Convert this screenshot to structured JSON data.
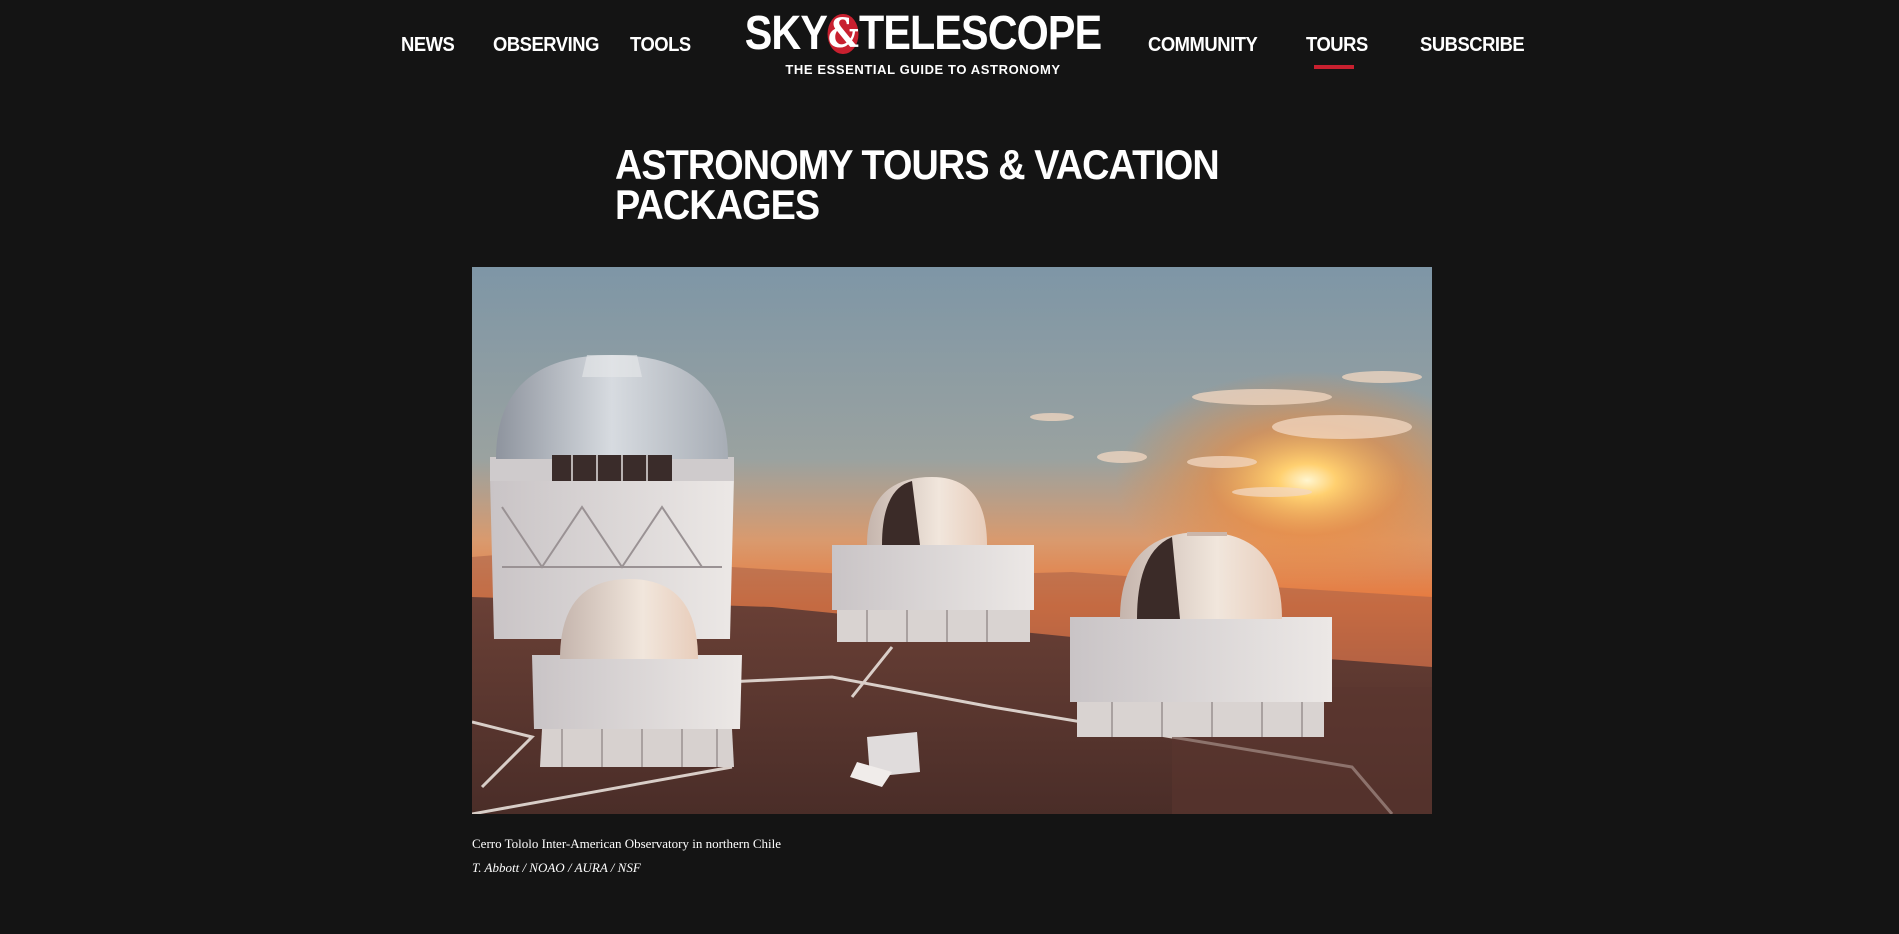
{
  "nav": {
    "left": [
      {
        "label": "NEWS"
      },
      {
        "label": "OBSERVING"
      },
      {
        "label": "TOOLS"
      }
    ],
    "right": [
      {
        "label": "COMMUNITY"
      },
      {
        "label": "TOURS",
        "active": true
      },
      {
        "label": "SUBSCRIBE"
      }
    ],
    "active_color": "#c8202f"
  },
  "logo": {
    "word_left": "SKY",
    "ampersand": "&",
    "word_right": "TELESCOPE",
    "tagline": "THE ESSENTIAL GUIDE TO ASTRONOMY",
    "accent_color": "#c8202f"
  },
  "page": {
    "title": "ASTRONOMY TOURS & VACATION PACKAGES",
    "background": "#141414"
  },
  "hero": {
    "caption": "Cerro Tololo Inter-American Observatory in northern Chile",
    "credit": "T. Abbott / NOAO / AURA / NSF"
  }
}
